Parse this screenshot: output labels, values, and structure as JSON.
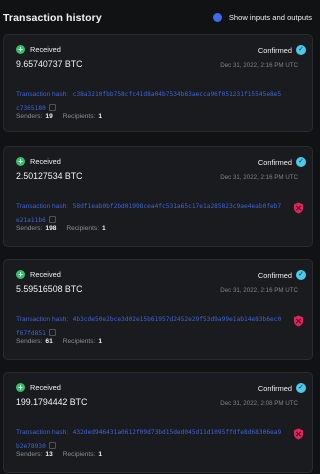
{
  "header": {
    "title": "Transaction history",
    "toggle_label": "Show inputs and outputs"
  },
  "labels": {
    "hash_label": "Transaction hash:",
    "senders_label": "Senders:",
    "recipients_label": "Recipients:"
  },
  "colors": {
    "accent": "#3b6cf0",
    "received": "#2ec26b",
    "confirmed": "#4cc9e8",
    "risk": "#e0245e"
  },
  "transactions": [
    {
      "status": "Received",
      "confirmation": "Confirmed",
      "amount": "9.65740737 BTC",
      "date": "Dec 31, 2022, 2:16 PM UTC",
      "hash": "c38a3210fbb758cfc41d8a04b7534b83aecca96f051231f15545e8e5c7365180",
      "senders": "19",
      "recipients": "1",
      "risk_icon": false
    },
    {
      "status": "Received",
      "confirmation": "Confirmed",
      "amount": "2.50127534 BTC",
      "date": "Dec 31, 2022, 2:16 PM UTC",
      "hash": "58df1eab0bf2bd01998cea4fc531a65c17e1a285823c9ae4eab0feb7e21a11b6",
      "senders": "198",
      "recipients": "1",
      "risk_icon": true
    },
    {
      "status": "Received",
      "confirmation": "Confirmed",
      "amount": "5.59516508 BTC",
      "date": "Dec 31, 2022, 2:16 PM UTC",
      "hash": "4b3cde50e2bce3d02e15b61957d2452e29f53d9a99e1ab14e83b6ec0f67fd851",
      "senders": "61",
      "recipients": "1",
      "risk_icon": true
    },
    {
      "status": "Received",
      "confirmation": "Confirmed",
      "amount": "199.1794442 BTC",
      "date": "Dec 31, 2022, 2:08 PM UTC",
      "hash": "432ded946431a0612f09d73bd15ded045d11d1095ffdfe8d68306ea9b2e78930",
      "senders": "13",
      "recipients": "1",
      "risk_icon": true
    }
  ]
}
